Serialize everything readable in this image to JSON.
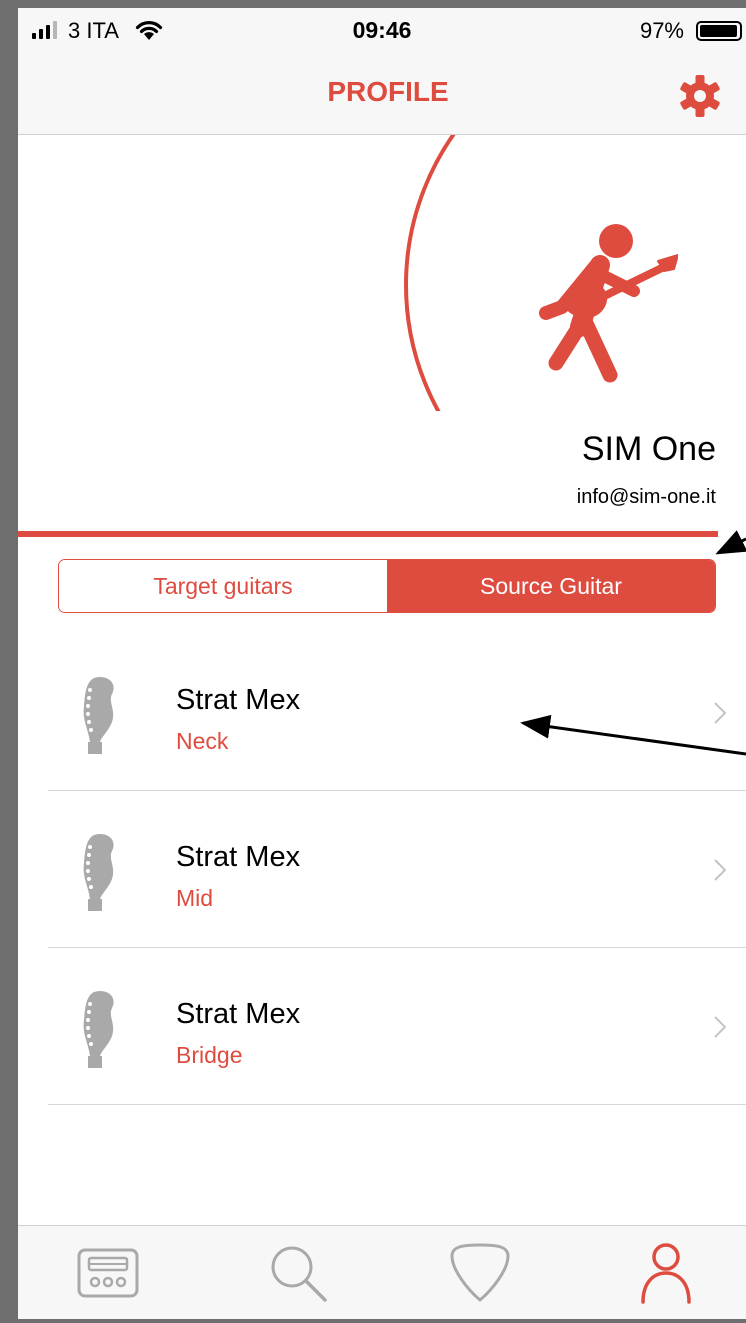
{
  "status_bar": {
    "carrier": "3 ITA",
    "time": "09:46",
    "battery_percent": "97%",
    "battery_level": 0.97,
    "signal_bars_on": 3,
    "signal_bars_total": 4
  },
  "nav": {
    "title": "PROFILE",
    "settings_icon": "gear-icon"
  },
  "profile": {
    "avatar_icon": "guitarist-icon",
    "name": "SIM One",
    "email": "info@sim-one.it"
  },
  "segmented": {
    "options": [
      "Target guitars",
      "Source Guitar"
    ],
    "selected": "Source Guitar"
  },
  "guitars": [
    {
      "name": "Strat Mex",
      "position": "Neck",
      "icon": "headstock-icon"
    },
    {
      "name": "Strat Mex",
      "position": "Mid",
      "icon": "headstock-icon"
    },
    {
      "name": "Strat Mex",
      "position": "Bridge",
      "icon": "headstock-icon"
    }
  ],
  "tab_bar": {
    "tabs": [
      "device-tab",
      "search-tab",
      "pick-tab",
      "profile-tab"
    ],
    "active": "profile-tab"
  },
  "colors": {
    "accent": "#de4c3f",
    "icon_gray": "#a9a9a9",
    "bar_bg": "#f7f7f7"
  }
}
